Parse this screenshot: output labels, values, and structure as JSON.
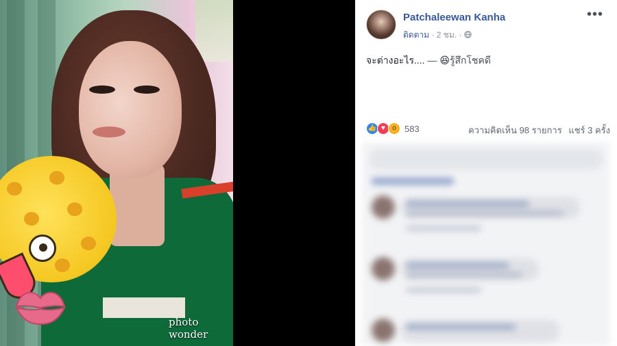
{
  "photo": {
    "watermark": "photo wonder"
  },
  "post": {
    "author_name": "Patchaleewan Kanha",
    "follow_label": "ติดตาม",
    "time": "2 ชม.",
    "meta_separator": "·",
    "privacy_icon": "globe-icon",
    "more_icon": "more-options-icon",
    "more_glyph": "•••",
    "text": "จะต่างอะไร....",
    "feeling_dash": "—",
    "feeling_emoji": "😆",
    "feeling_text": "รู้สึกโชคดี"
  },
  "reactions": {
    "icons": [
      "like-reaction-icon",
      "love-reaction-icon",
      "wow-reaction-icon"
    ],
    "count": "583"
  },
  "stats": {
    "comments": "ความคิดเห็น 98 รายการ",
    "shares": "แชร์ 3 ครั้ง"
  },
  "colors": {
    "link": "#385898",
    "meta": "#90949c",
    "like": "#2d88ff",
    "love": "#f33e58",
    "wow": "#f7b125"
  }
}
